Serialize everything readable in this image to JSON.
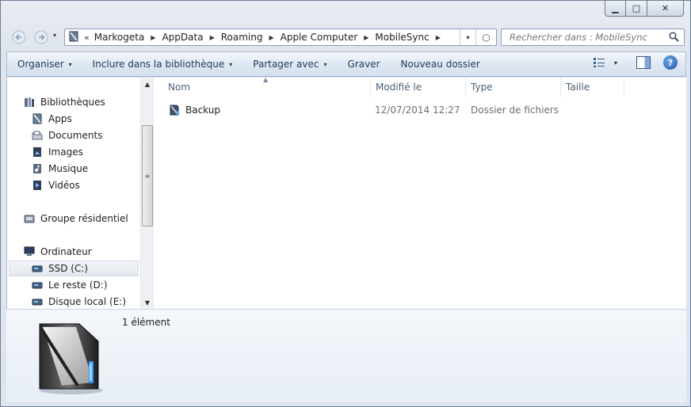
{
  "window": {
    "controls": {
      "minimize": "▁",
      "maximize": "□",
      "close": "✕"
    }
  },
  "nav": {
    "back_icon": "back-arrow-icon",
    "forward_icon": "forward-arrow-icon",
    "history_caret": "▾"
  },
  "address": {
    "overflow": "«",
    "crumbs": [
      "Markogeta",
      "AppData",
      "Roaming",
      "Apple Computer",
      "MobileSync"
    ],
    "separator": "▶",
    "dropdown": "▾",
    "refresh": "○"
  },
  "search": {
    "placeholder": "Rechercher dans : MobileSync"
  },
  "toolbar": {
    "organize": "Organiser",
    "include_library": "Inclure dans la bibliothèque",
    "share_with": "Partager avec",
    "burn": "Graver",
    "new_folder": "Nouveau dossier",
    "caret": "▾",
    "help": "?"
  },
  "sidebar": {
    "libraries": "Bibliothèques",
    "library_items": [
      "Apps",
      "Documents",
      "Images",
      "Musique",
      "Vidéos"
    ],
    "homegroup": "Groupe résidentiel",
    "computer": "Ordinateur",
    "drives": [
      "SSD (C:)",
      "Le reste (D:)",
      "Disque local (E:)"
    ],
    "selected": "SSD (C:)"
  },
  "columns": {
    "name": "Nom",
    "modified": "Modifié le",
    "type": "Type",
    "size": "Taille"
  },
  "files": [
    {
      "name": "Backup",
      "modified": "12/07/2014 12:27",
      "type": "Dossier de fichiers",
      "size": ""
    }
  ],
  "details": {
    "count": "1 élément"
  }
}
